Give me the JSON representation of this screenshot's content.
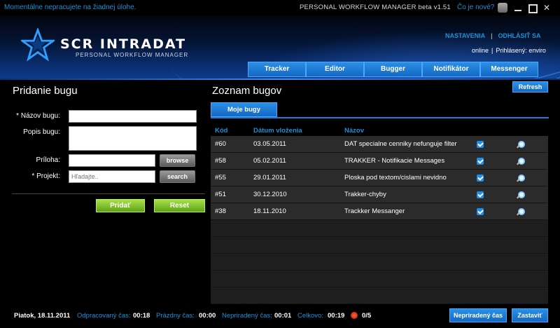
{
  "topbar": {
    "status": "Momentálne nepracujete na žiadnej úlohe.",
    "app_title": "PERSONAL WORKFLOW MANAGER beta v1.51",
    "news_link": "Čo je nové?"
  },
  "header": {
    "logo_text": "SCR INTRADAT",
    "logo_sub": "PERSONAL WORKFLOW MANAGER",
    "settings_link": "NASTAVENIA",
    "separator": "|",
    "logout_link": "ODHLÁSIŤ SA",
    "online_status": "online",
    "logged_in_label": "Prihlásený: enviro"
  },
  "nav": {
    "tabs": [
      "Tracker",
      "Editor",
      "Bugger",
      "Notifikátor",
      "Messenger"
    ]
  },
  "left_panel": {
    "title": "Pridanie bugu",
    "name_label": "* Názov bugu:",
    "desc_label": "Popis bugu:",
    "attachment_label": "Príloha:",
    "project_label": "* Projekt:",
    "project_placeholder": "Hľadajte..",
    "browse_label": "browse",
    "search_label": "search",
    "add_label": "Pridať",
    "reset_label": "Reset"
  },
  "right_panel": {
    "title": "Zoznam bugov",
    "refresh_label": "Refresh",
    "subtab_label": "Moje bugy",
    "columns": {
      "code": "Kód",
      "date": "Dátum vloženia",
      "name": "Názov"
    },
    "rows": [
      {
        "code": "#60",
        "date": "03.05.2011",
        "name": "DAT specialne cenniky nefunguje filter"
      },
      {
        "code": "#58",
        "date": "05.02.2011",
        "name": "TRAKKER - Notifikacie Messages"
      },
      {
        "code": "#55",
        "date": "29.01.2011",
        "name": "Ploska pod textom/cislami nevidno"
      },
      {
        "code": "#51",
        "date": "30.12.2010",
        "name": "Trakker-chyby"
      },
      {
        "code": "#38",
        "date": "18.11.2010",
        "name": "Trackker Messanger"
      }
    ]
  },
  "footer": {
    "date": "Piatok, 18.11.2011",
    "worked_label": "Odpracovaný čas:",
    "worked_value": "00:18",
    "idle_label": "Prázdny čas:",
    "idle_value": "00:00",
    "unassigned_label": "Nepriradený čas:",
    "unassigned_value": "00:01",
    "total_label": "Celkovo:",
    "total_value": "00:19",
    "tasks_value": "0/5",
    "unassigned_btn": "Nepriradený čas",
    "stop_btn": "Zastaviť"
  },
  "colors": {
    "accent_blue": "#1e90d6",
    "tab_blue": "#1e7ad8",
    "green": "#7cc22a"
  }
}
